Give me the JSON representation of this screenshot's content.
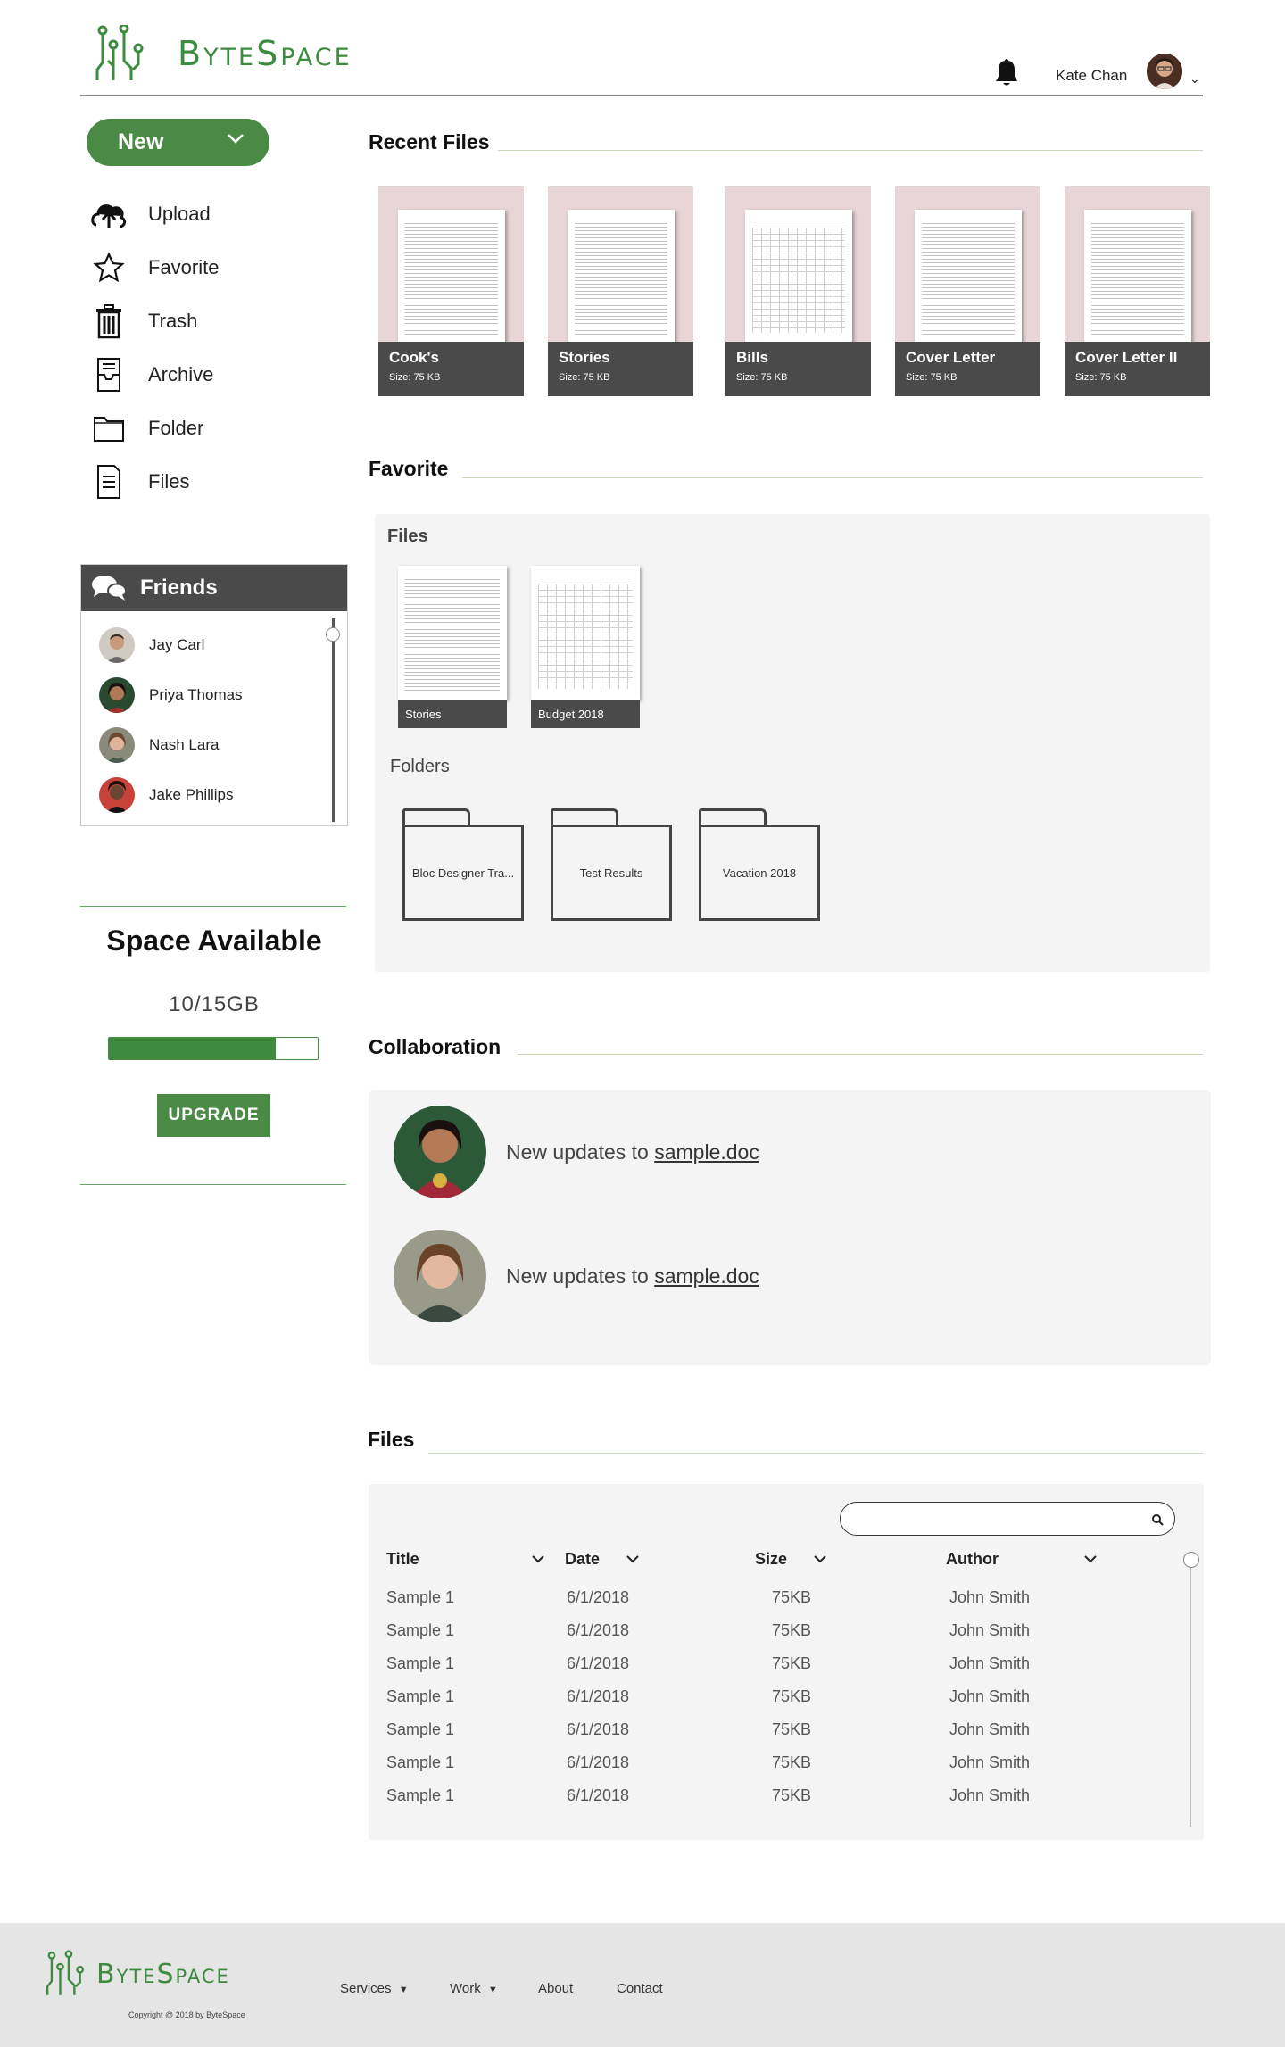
{
  "header": {
    "brand": "ByteSpace",
    "user_name": "Kate Chan"
  },
  "sidebar": {
    "new_label": "New",
    "items": [
      {
        "label": "Upload",
        "icon": "upload-icon"
      },
      {
        "label": "Favorite",
        "icon": "star-icon"
      },
      {
        "label": "Trash",
        "icon": "trash-icon"
      },
      {
        "label": "Archive",
        "icon": "archive-icon"
      },
      {
        "label": "Folder",
        "icon": "folder-icon"
      },
      {
        "label": "Files",
        "icon": "file-icon"
      }
    ],
    "friends": {
      "title": "Friends",
      "list": [
        "Jay Carl",
        "Priya Thomas",
        "Nash Lara",
        "Jake Phillips"
      ]
    },
    "space": {
      "title": "Space Available",
      "value": "10/15GB",
      "used_fraction": 0.8,
      "upgrade_label": "UPGRADE"
    }
  },
  "recent": {
    "title": "Recent Files",
    "files": [
      {
        "name": "Cook's",
        "size": "Size: 75 KB",
        "kind": "text"
      },
      {
        "name": "Stories",
        "size": "Size: 75 KB",
        "kind": "text"
      },
      {
        "name": "Bills",
        "size": "Size: 75 KB",
        "kind": "sheet"
      },
      {
        "name": "Cover Letter",
        "size": "Size: 75 KB",
        "kind": "text"
      },
      {
        "name": "Cover Letter II",
        "size": "Size: 75 KB",
        "kind": "text"
      }
    ]
  },
  "favorite": {
    "title": "Favorite",
    "files_label": "Files",
    "files": [
      {
        "name": "Stories",
        "kind": "text"
      },
      {
        "name": "Budget 2018",
        "kind": "sheet"
      }
    ],
    "folders_label": "Folders",
    "folders": [
      "Bloc Designer Tra...",
      "Test Results",
      "Vacation 2018"
    ]
  },
  "collaboration": {
    "title": "Collaboration",
    "updates": [
      {
        "text": "New updates to ",
        "link": "sample.doc"
      },
      {
        "text": "New updates to ",
        "link": "sample.doc"
      }
    ]
  },
  "files_table": {
    "title": "Files",
    "columns": [
      "Title",
      "Date",
      "Size",
      "Author"
    ],
    "rows": [
      [
        "Sample 1",
        "6/1/2018",
        "75KB",
        "John Smith"
      ],
      [
        "Sample 1",
        "6/1/2018",
        "75KB",
        "John Smith"
      ],
      [
        "Sample 1",
        "6/1/2018",
        "75KB",
        "John Smith"
      ],
      [
        "Sample 1",
        "6/1/2018",
        "75KB",
        "John Smith"
      ],
      [
        "Sample 1",
        "6/1/2018",
        "75KB",
        "John Smith"
      ],
      [
        "Sample 1",
        "6/1/2018",
        "75KB",
        "John Smith"
      ],
      [
        "Sample 1",
        "6/1/2018",
        "75KB",
        "John Smith"
      ]
    ]
  },
  "footer": {
    "brand": "ByteSpace",
    "nav": [
      "Services",
      "Work",
      "About",
      "Contact"
    ],
    "copyright": "Copyright @ 2018 by ByteSpace"
  },
  "colors": {
    "accent": "#4a8a45",
    "card_bg": "#e8d5d8",
    "caption_bg": "#4a4a4a",
    "panel_bg": "#f4f4f4"
  }
}
